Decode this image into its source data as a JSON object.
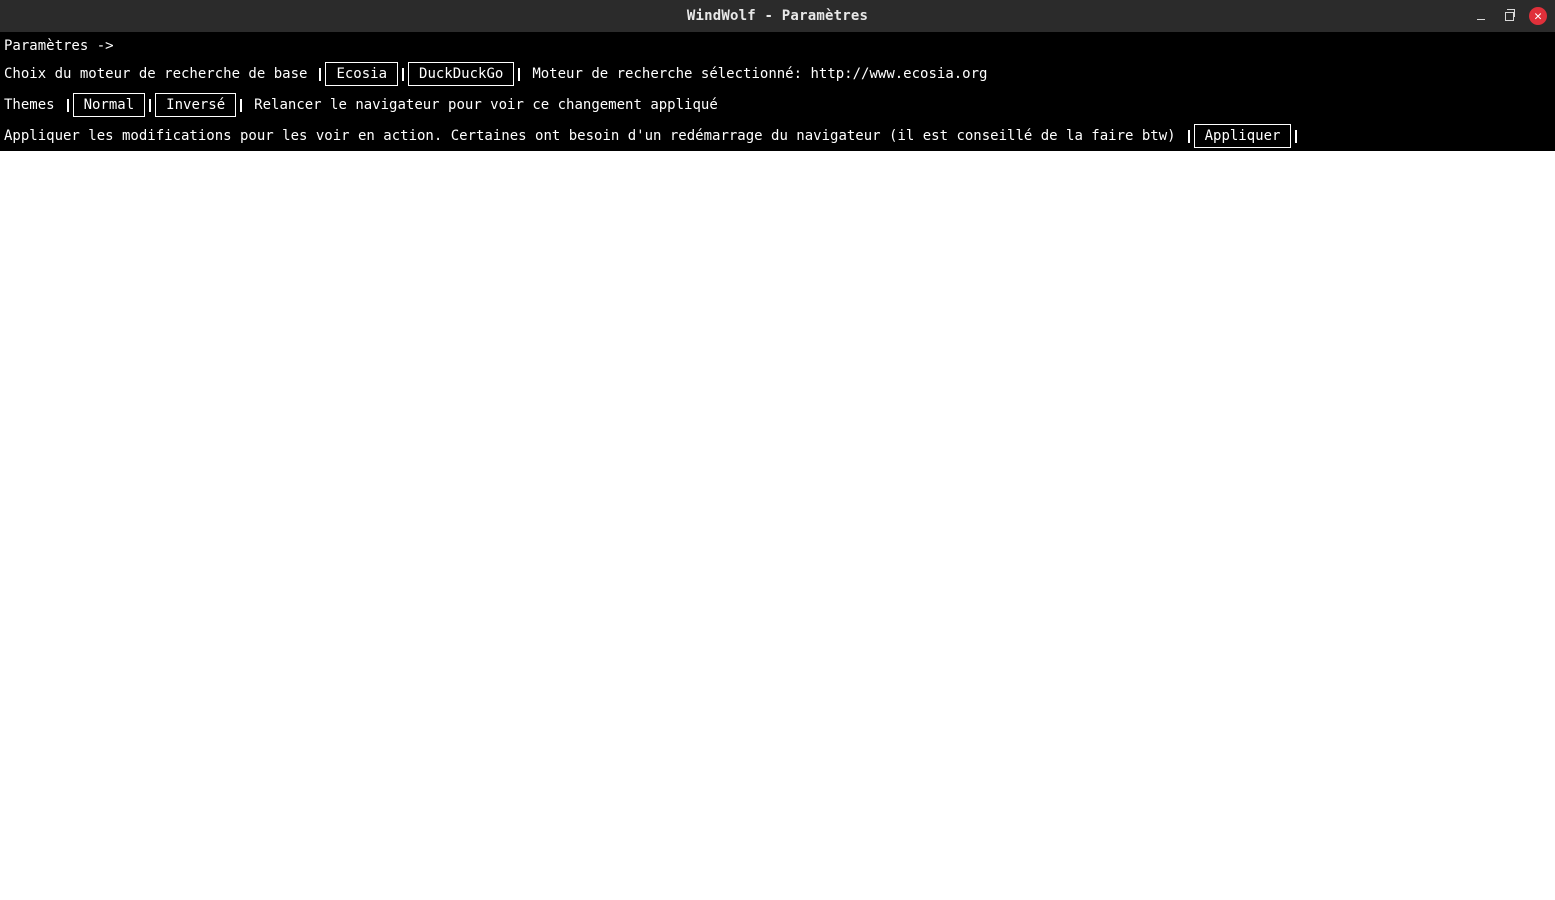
{
  "window": {
    "title": "WindWolf - Paramètres",
    "controls": {
      "minimize": "–",
      "close": "✕"
    }
  },
  "settings": {
    "header": "Paramètres ->",
    "search_engine": {
      "label": "Choix du moteur de recherche de base",
      "options": [
        "Ecosia",
        "DuckDuckGo"
      ],
      "selected_text": "Moteur de recherche sélectionné: http://www.ecosia.org"
    },
    "themes": {
      "label": "Themes",
      "options": [
        "Normal",
        "Inversé"
      ],
      "note": "Relancer le navigateur pour voir ce changement appliqué"
    },
    "apply": {
      "text": "Appliquer les modifications pour les voir en action. Certaines ont besoin d'un redémarrage du navigateur (il est conseillé de la faire btw)",
      "button_label": "Appliquer"
    }
  },
  "colors": {
    "titlebar_bg": "#2b2b2b",
    "content_bg": "#000000",
    "text": "#ffffff",
    "close_button": "#e0303a"
  }
}
